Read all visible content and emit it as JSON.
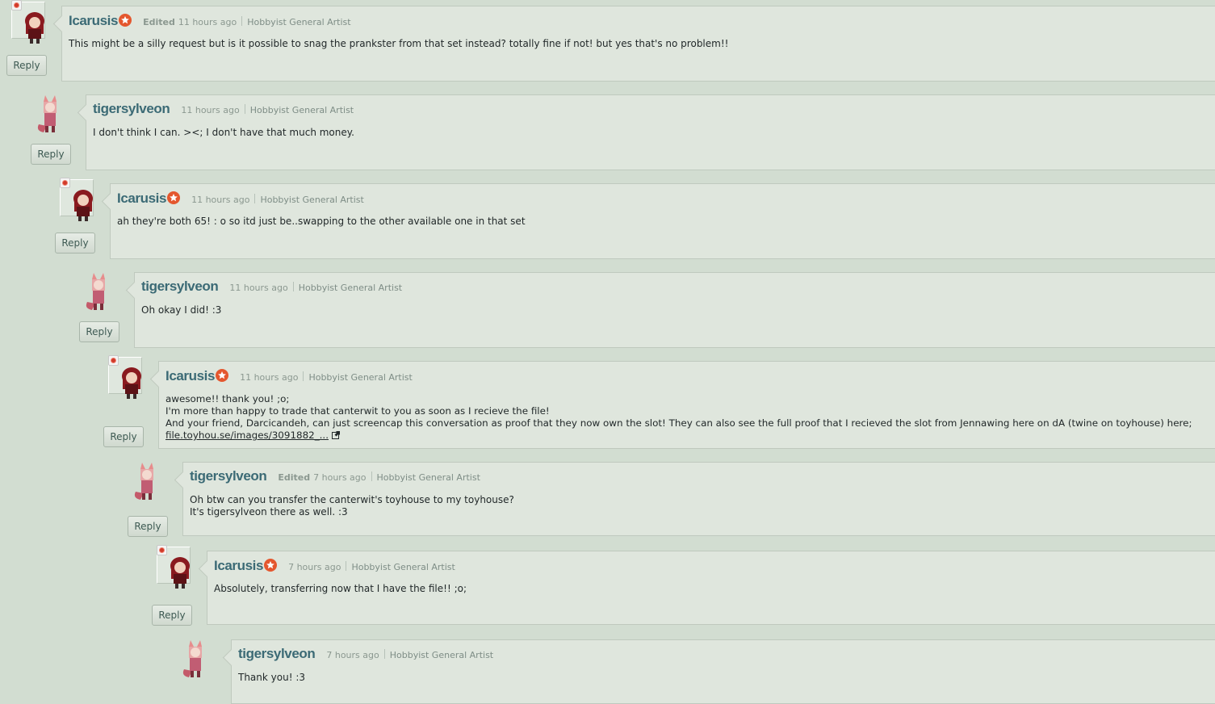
{
  "reply_label": "Reply",
  "comments": [
    {
      "user": "Icarusis",
      "edited": "Edited",
      "time": "11 hours ago",
      "role": "Hobbyist General Artist",
      "lines": [
        "This might be a silly request but is it possible to snag the prankster from that set instead? totally fine if not! but yes that's no problem!!"
      ]
    },
    {
      "user": "tigersylveon",
      "edited": "",
      "time": "11 hours ago",
      "role": "Hobbyist General Artist",
      "lines": [
        "I don't think I can. ><; I don't have that much money."
      ]
    },
    {
      "user": "Icarusis",
      "edited": "",
      "time": "11 hours ago",
      "role": "Hobbyist General Artist",
      "lines": [
        "ah they're both 65! : o so itd just be..swapping to the other available one in that set"
      ]
    },
    {
      "user": "tigersylveon",
      "edited": "",
      "time": "11 hours ago",
      "role": "Hobbyist General Artist",
      "lines": [
        "Oh okay I did! :3"
      ]
    },
    {
      "user": "Icarusis",
      "edited": "",
      "time": "11 hours ago",
      "role": "Hobbyist General Artist",
      "lines": [
        "awesome!! thank you! ;o;",
        "I'm more than happy to trade that canterwit to you as soon as I recieve the file!",
        "And your friend, Darcicandeh, can just screencap this conversation as proof that they now own the slot! They can also see the full proof that I recieved the slot from Jennawing here on dA (twine on toyhouse) here;"
      ],
      "link": "file.toyhou.se/images/3091882_..."
    },
    {
      "user": "tigersylveon",
      "edited": "Edited",
      "time": "7 hours ago",
      "role": "Hobbyist General Artist",
      "lines": [
        "Oh btw can you transfer the canterwit's toyhouse to my toyhouse?",
        "It's tigersylveon there as well. :3"
      ]
    },
    {
      "user": "Icarusis",
      "edited": "",
      "time": "7 hours ago",
      "role": "Hobbyist General Artist",
      "lines": [
        "Absolutely, transferring now that I have the file!! ;o;"
      ]
    },
    {
      "user": "tigersylveon",
      "edited": "",
      "time": "7 hours ago",
      "role": "Hobbyist General Artist",
      "lines": [
        "Thank you! :3"
      ]
    }
  ]
}
